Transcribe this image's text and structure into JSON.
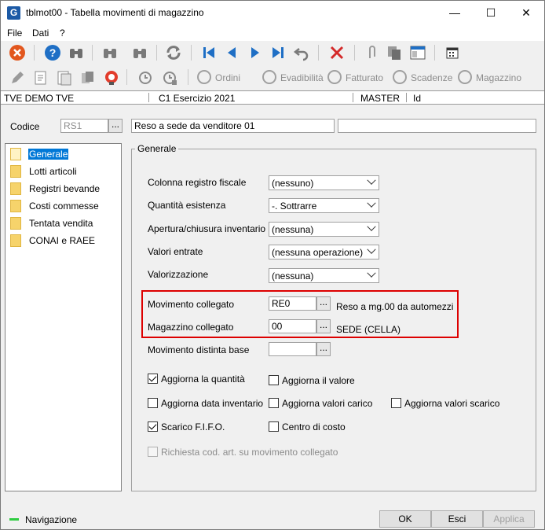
{
  "window": {
    "title": "tblmot00 - Tabella movimenti di magazzino",
    "app_icon": "G",
    "controls": {
      "minimize": "—",
      "maximize": "☐",
      "close": "✕"
    }
  },
  "menu": {
    "items": [
      "File",
      "Dati",
      "?"
    ]
  },
  "toolbar_secondary": {
    "ordini": "Ordini",
    "evadibilita": "Evadibilità",
    "fatturato": "Fatturato",
    "scadenze": "Scadenze",
    "magazzino": "Magazzino"
  },
  "info_bar": {
    "company": "TVE DEMO TVE",
    "exercise": "C1 Esercizio 2021",
    "user": "MASTER",
    "id": "Id"
  },
  "header": {
    "codice_label": "Codice",
    "codice_value": "RS1",
    "description": "Reso a sede da venditore 01",
    "dots": "..."
  },
  "nav": {
    "items": [
      "Generale",
      "Lotti articoli",
      "Registri bevande",
      "Costi commesse",
      "Tentata vendita",
      "CONAI e RAEE"
    ],
    "selected": "Generale"
  },
  "panel": {
    "title": "Generale",
    "colonna_registro_label": "Colonna registro fiscale",
    "colonna_registro_value": "(nessuno)",
    "quantita_label": "Quantità esistenza",
    "quantita_value": "-. Sottrarre",
    "apertura_label": "Apertura/chiusura inventario",
    "apertura_value": "(nessuna)",
    "valori_entrate_label": "Valori entrate",
    "valori_entrate_value": "(nessuna operazione)",
    "valorizzazione_label": "Valorizzazione",
    "valorizzazione_value": "(nessuna)",
    "mov_collegato_label": "Movimento collegato",
    "mov_collegato_value": "RE0",
    "mov_collegato_desc": "Reso a mg.00 da automezzi",
    "mag_collegato_label": "Magazzino collegato",
    "mag_collegato_value": "00",
    "mag_collegato_desc": "SEDE (CELLA)",
    "mov_distinta_label": "Movimento distinta base",
    "mov_distinta_value": "",
    "checks": {
      "aggiorna_quantita": "Aggiorna la quantità",
      "aggiorna_valore": "Aggiorna il valore",
      "aggiorna_data_inv": "Aggiorna data inventario",
      "aggiorna_valori_carico": "Aggiorna valori carico",
      "aggiorna_valori_scarico": "Aggiorna valori scarico",
      "scarico_fifo": "Scarico F.I.F.O.",
      "centro_costo": "Centro di costo",
      "richiesta_cod": "Richiesta cod. art. su movimento collegato"
    }
  },
  "status": {
    "navigazione": "Navigazione"
  },
  "buttons": {
    "ok": "OK",
    "esci": "Esci",
    "applica": "Applica"
  }
}
